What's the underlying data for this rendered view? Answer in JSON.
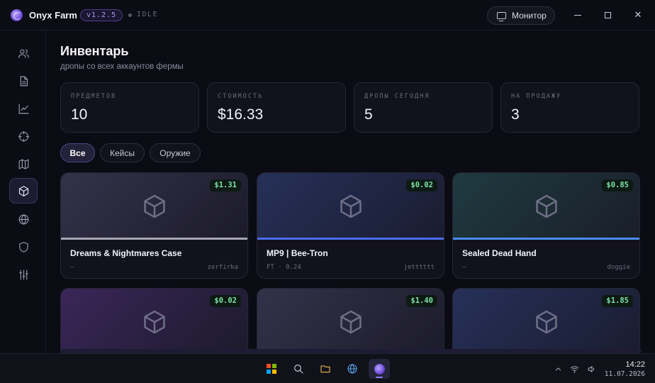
{
  "app": {
    "title": "Onyx Farm",
    "version": "v1.2.5",
    "status": "IDLE",
    "monitor_label": "Монитор"
  },
  "sidebar": {
    "items": [
      {
        "name": "users",
        "icon": "users-icon"
      },
      {
        "name": "logs",
        "icon": "file-icon"
      },
      {
        "name": "stats",
        "icon": "chart-icon"
      },
      {
        "name": "target",
        "icon": "crosshair-icon"
      },
      {
        "name": "map",
        "icon": "map-icon"
      },
      {
        "name": "inventory",
        "icon": "box-icon",
        "active": true
      },
      {
        "name": "network",
        "icon": "globe-icon"
      },
      {
        "name": "security",
        "icon": "shield-icon"
      },
      {
        "name": "settings",
        "icon": "sliders-icon"
      }
    ]
  },
  "page": {
    "title": "Инвентарь",
    "subtitle": "дропы со всех аккаунтов фермы"
  },
  "stats": [
    {
      "label": "предметов",
      "value": "10"
    },
    {
      "label": "стоимость",
      "value": "$16.33"
    },
    {
      "label": "дропы сегодня",
      "value": "5"
    },
    {
      "label": "на продажу",
      "value": "3"
    }
  ],
  "filters": [
    {
      "label": "Все",
      "active": true
    },
    {
      "label": "Кейсы",
      "active": false
    },
    {
      "label": "Оружие",
      "active": false
    }
  ],
  "cards": [
    {
      "name": "Dreams & Nightmares Case",
      "price": "$1.31",
      "meta": "—",
      "owner": "zerfirka",
      "rarity_color": "#a8a6b4",
      "bg_from": "#34324a",
      "bg_to": "#1c1b2a"
    },
    {
      "name": "MP9 | Bee-Tron",
      "price": "$0.02",
      "meta": "FT · 0.24",
      "owner": "jetttttt",
      "rarity_color": "#4b6ef0",
      "bg_from": "#263058",
      "bg_to": "#1a1c30"
    },
    {
      "name": "Sealed Dead Hand",
      "price": "$0.85",
      "meta": "—",
      "owner": "doggie",
      "rarity_color": "#4b8ef0",
      "bg_from": "#1f3a40",
      "bg_to": "#1a1e2a"
    },
    {
      "name": "",
      "price": "$0.02",
      "meta": "",
      "owner": "",
      "rarity_color": "#8a5ad8",
      "bg_from": "#3a2658",
      "bg_to": "#1c1a2c"
    },
    {
      "name": "",
      "price": "$1.40",
      "meta": "",
      "owner": "",
      "rarity_color": "#a8a6b4",
      "bg_from": "#34324a",
      "bg_to": "#1c1b2a"
    },
    {
      "name": "",
      "price": "$1.85",
      "meta": "",
      "owner": "",
      "rarity_color": "#4b6ef0",
      "bg_from": "#263058",
      "bg_to": "#1a1c30"
    }
  ],
  "taskbar": {
    "time": "14:22",
    "date": "11.07.2026",
    "apps": [
      "start-icon",
      "search-icon",
      "folder-icon",
      "browser-icon",
      "onyx-farm-icon"
    ]
  },
  "colors": {
    "accent": "#8a7cf0",
    "price_text": "#7ee0a8",
    "background": "#0b0b14"
  }
}
